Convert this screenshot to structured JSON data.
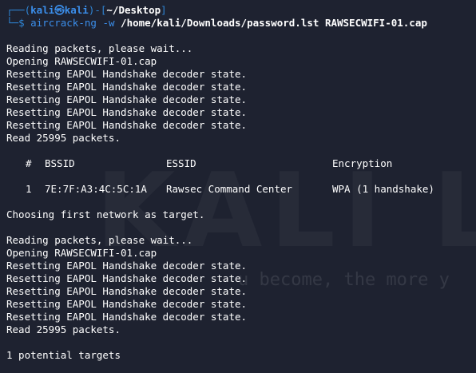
{
  "prompt": {
    "line1_pre": "┌──(",
    "user": "kali㉿kali",
    "line1_mid": ")-[",
    "path": "~/Desktop",
    "line1_end": "]",
    "line2_pre": "└─",
    "dollar": "$",
    "command": "aircrack-ng",
    "flag": "-w",
    "arg1": "/home/kali/Downloads/password.lst",
    "arg2": "RAWSECWIFI-01.cap"
  },
  "block1": [
    "Reading packets, please wait...",
    "Opening RAWSECWIFI-01.cap",
    "Resetting EAPOL Handshake decoder state.",
    "Resetting EAPOL Handshake decoder state.",
    "Resetting EAPOL Handshake decoder state.",
    "Resetting EAPOL Handshake decoder state.",
    "Resetting EAPOL Handshake decoder state.",
    "Read 25995 packets."
  ],
  "table": {
    "headers": {
      "num": "#",
      "bssid": "BSSID",
      "essid": "ESSID",
      "encryption": "Encryption"
    },
    "rows": [
      {
        "num": "1",
        "bssid": "7E:7F:A3:4C:5C:1A",
        "essid": "Rawsec Command Center",
        "encryption": "WPA (1 handshake)"
      }
    ]
  },
  "choosing": "Choosing first network as target.",
  "block2": [
    "Reading packets, please wait...",
    "Opening RAWSECWIFI-01.cap",
    "Resetting EAPOL Handshake decoder state.",
    "Resetting EAPOL Handshake decoder state.",
    "Resetting EAPOL Handshake decoder state.",
    "Resetting EAPOL Handshake decoder state.",
    "Resetting EAPOL Handshake decoder state.",
    "Read 25995 packets."
  ],
  "summary": "1 potential targets",
  "watermark": {
    "logo": "KALI LI",
    "tagline": "u become, the more y"
  },
  "colors": {
    "background": "#1e2230",
    "prompt_blue": "#3b8eea",
    "text": "#ffffff"
  }
}
